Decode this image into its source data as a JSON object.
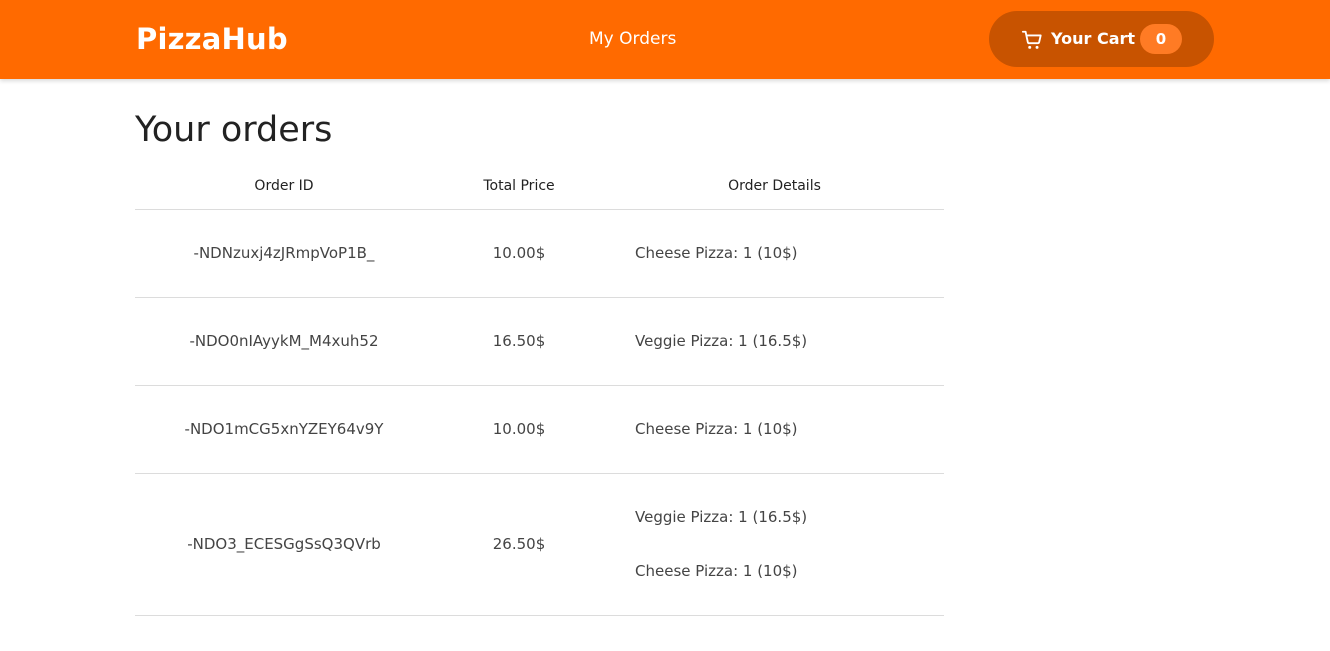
{
  "header": {
    "brand": "PizzaHub",
    "nav_link": "My Orders",
    "cart_label": "Your Cart",
    "cart_count": "0",
    "accent_color": "#ff6a00",
    "cart_button_color": "#c85300",
    "cart_icon": "cart-icon"
  },
  "page": {
    "title": "Your orders"
  },
  "table": {
    "headers": {
      "order_id": "Order ID",
      "total_price": "Total Price",
      "order_details": "Order Details"
    },
    "rows": [
      {
        "order_id": "-NDNzuxj4zJRmpVoP1B_",
        "total_price": "10.00$",
        "details": [
          "Cheese Pizza: 1 (10$)"
        ]
      },
      {
        "order_id": "-NDO0nIAyykM_M4xuh52",
        "total_price": "16.50$",
        "details": [
          "Veggie Pizza: 1 (16.5$)"
        ]
      },
      {
        "order_id": "-NDO1mCG5xnYZEY64v9Y",
        "total_price": "10.00$",
        "details": [
          "Cheese Pizza: 1 (10$)"
        ]
      },
      {
        "order_id": "-NDO3_ECESGgSsQ3QVrb",
        "total_price": "26.50$",
        "details": [
          "Veggie Pizza: 1 (16.5$)",
          "Cheese Pizza: 1 (10$)"
        ]
      }
    ]
  }
}
